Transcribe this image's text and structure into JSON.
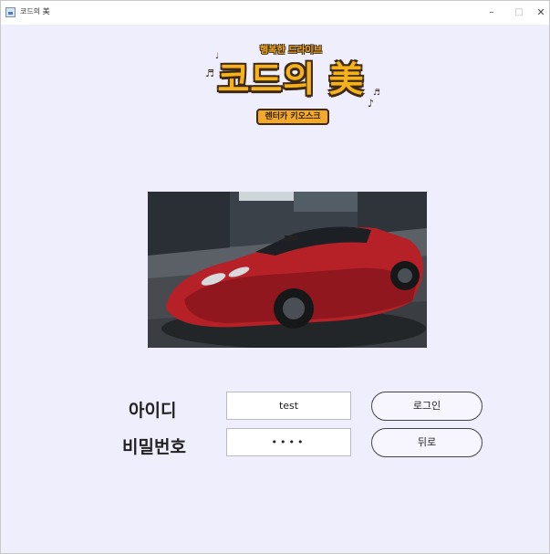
{
  "window": {
    "title": "코드의 美",
    "minimize_symbol": "–",
    "maximize_symbol": "□",
    "close_symbol": "✕"
  },
  "logo": {
    "subtitle": "행복한 드라이브",
    "title": "코드의 美",
    "badge": "렌터카 키오스크",
    "note_symbols": [
      "♩",
      "♬",
      "♬",
      "♪"
    ]
  },
  "form": {
    "id_label": "아이디",
    "id_value": "test",
    "password_label": "비밀번호",
    "password_value": "••••",
    "login_button": "로그인",
    "back_button": "뒤로"
  },
  "colors": {
    "window_background": "#efeefd",
    "logo_yellow": "#f5b21d",
    "logo_outline": "#3e2a14"
  }
}
